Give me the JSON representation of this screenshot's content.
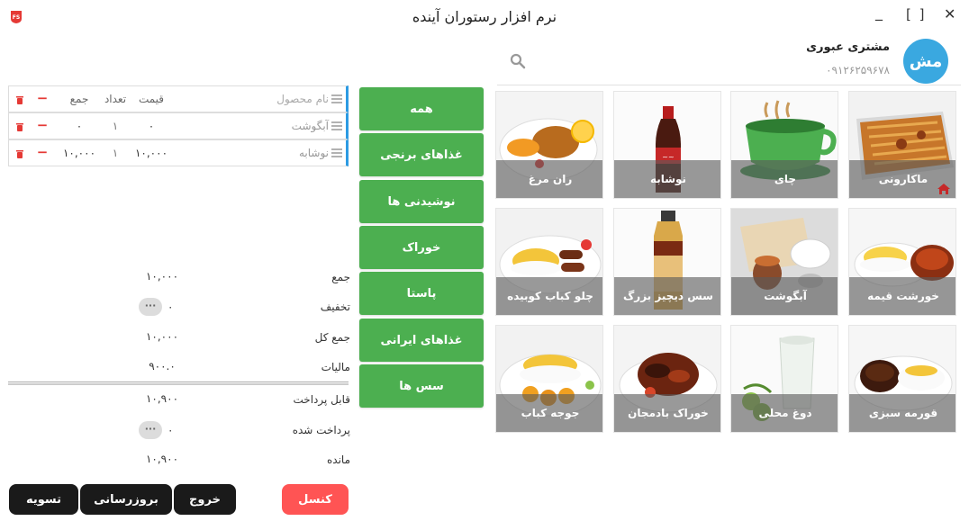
{
  "window": {
    "title": "نرم افزار رستوران آینده",
    "minimize": "_",
    "maximize": "[ ]",
    "close": "✕"
  },
  "customer": {
    "avatar_initials": "مش",
    "name": "مشتری عبوری",
    "phone": "۰۹۱۲۶۲۵۹۶۷۸"
  },
  "order_table": {
    "header": {
      "name": "نام محصول",
      "price": "قیمت",
      "qty": "تعداد",
      "sum": "جمع"
    },
    "rows": [
      {
        "name": "آبگوشت",
        "price": "۰",
        "qty": "۱",
        "sum": "۰"
      },
      {
        "name": "نوشابه",
        "price": "۱۰,۰۰۰",
        "qty": "۱",
        "sum": "۱۰,۰۰۰"
      }
    ],
    "minus_label": "−"
  },
  "categories": [
    "همه",
    "غذاهای برنجی",
    "نوشیدنی ها",
    "خوراک",
    "پاستا",
    "غذاهای ایرانی",
    "سس ها"
  ],
  "products": [
    {
      "name": "ماکارونی",
      "pic": "pasta"
    },
    {
      "name": "چای",
      "pic": "tea"
    },
    {
      "name": "نوشابه",
      "pic": "soda"
    },
    {
      "name": "ران مرغ",
      "pic": "chicken"
    },
    {
      "name": "خورشت قیمه",
      "pic": "gheymeh"
    },
    {
      "name": "آبگوشت",
      "pic": "abgoosht"
    },
    {
      "name": "سس دیچیز بزرگ",
      "pic": "sauce"
    },
    {
      "name": "چلو کباب کوبیده",
      "pic": "kabab"
    },
    {
      "name": "قورمه سبزی",
      "pic": "ghormeh"
    },
    {
      "name": "دوغ محلی",
      "pic": "doogh"
    },
    {
      "name": "خوراک بادمجان",
      "pic": "eggplant"
    },
    {
      "name": "جوجه کباب",
      "pic": "joojeh"
    }
  ],
  "totals": {
    "subtotal_label": "جمع",
    "subtotal_value": "۱۰,۰۰۰",
    "discount_label": "تخفیف",
    "discount_value": "۰",
    "grand_label": "جمع کل",
    "grand_value": "۱۰,۰۰۰",
    "tax_label": "مالیات",
    "tax_value": "۹۰۰.۰",
    "payable_label": "قابل پرداخت",
    "payable_value": "۱۰,۹۰۰",
    "paid_label": "پرداخت شده",
    "paid_value": "۰",
    "remaining_label": "مانده",
    "remaining_value": "۱۰,۹۰۰",
    "more_label": "···"
  },
  "buttons": {
    "settle": "تسویه",
    "update": "بروزرسانی",
    "exit": "خروج",
    "cancel": "کنسل"
  },
  "colors": {
    "category_green": "#4caf50",
    "avatar_blue": "#3aa8e0",
    "cancel_red": "#ff5454",
    "row_accent": "#2d9be3"
  }
}
